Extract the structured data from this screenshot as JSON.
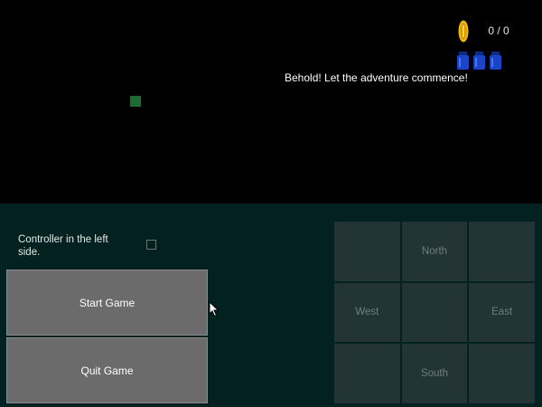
{
  "hud": {
    "coin_icon": "gold-coin-icon",
    "coin_counter": "0 / 0",
    "jar_icon": "blue-jar-icon",
    "jar_count": 3,
    "message": "Behold! Let the adventure commence!"
  },
  "player": {
    "icon": "green-square-player"
  },
  "options": {
    "controller_left_label": "Controller in the left side.",
    "controller_left_checked": false
  },
  "menu": {
    "start_label": "Start Game",
    "quit_label": "Quit Game"
  },
  "dpad": {
    "north_label": "North",
    "west_label": "West",
    "east_label": "East",
    "south_label": "South"
  },
  "colors": {
    "viewport_bg": "#000000",
    "panel_bg": "#032121",
    "button_bg": "#6b6b6b",
    "dpad_cell_bg": "#233434",
    "dpad_text": "#707d7d",
    "player": "#1f6a32",
    "coin": "#f2b80e",
    "jar": "#1a45c9"
  }
}
